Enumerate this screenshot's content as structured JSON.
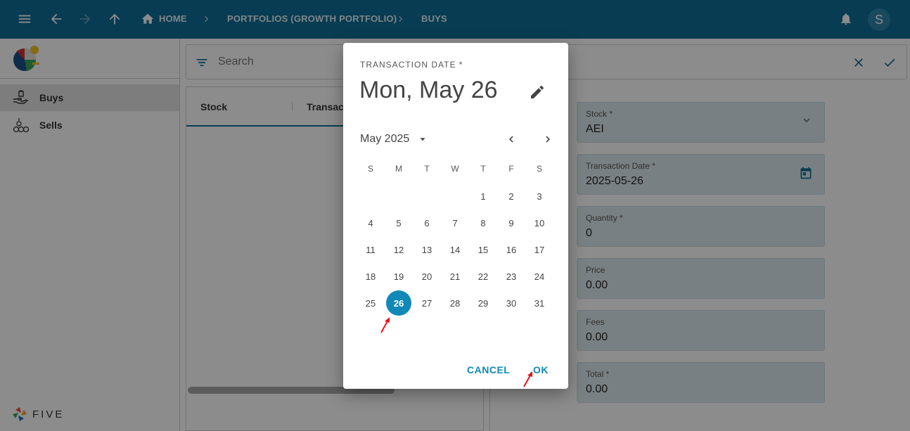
{
  "topbar": {
    "breadcrumbs": [
      "HOME",
      "PORTFOLIOS (GROWTH PORTFOLIO)",
      "BUYS"
    ],
    "avatar_letter": "S"
  },
  "sidebar": {
    "items": [
      {
        "label": "Buys",
        "active": true
      },
      {
        "label": "Sells",
        "active": false
      }
    ],
    "footer_logo": "FIVE"
  },
  "search": {
    "placeholder": "Search"
  },
  "list": {
    "columns": [
      "Stock",
      "Transac"
    ]
  },
  "form": {
    "fields": [
      {
        "label": "Stock *",
        "value": "AEI"
      },
      {
        "label": "Transaction Date *",
        "value": "2025-05-26"
      },
      {
        "label": "Quantity *",
        "value": "0"
      },
      {
        "label": "Price",
        "value": "0.00"
      },
      {
        "label": "Fees",
        "value": "0.00"
      },
      {
        "label": "Total *",
        "value": "0.00"
      }
    ]
  },
  "dialog": {
    "label": "TRANSACTION DATE *",
    "selected_display": "Mon, May 26",
    "month_year": "May 2025",
    "weekdays": [
      "S",
      "M",
      "T",
      "W",
      "T",
      "F",
      "S"
    ],
    "days": [
      "1",
      "2",
      "3",
      "4",
      "5",
      "6",
      "7",
      "8",
      "9",
      "10",
      "11",
      "12",
      "13",
      "14",
      "15",
      "16",
      "17",
      "18",
      "19",
      "20",
      "21",
      "22",
      "23",
      "24",
      "25",
      "26",
      "27",
      "28",
      "29",
      "30",
      "31"
    ],
    "first_weekday_index": 4,
    "selected_day": "26",
    "cancel_label": "CANCEL",
    "ok_label": "OK"
  },
  "colors": {
    "topbar": "#0e6d96",
    "accent": "#1189b7",
    "field_bg": "#dde9ef"
  }
}
